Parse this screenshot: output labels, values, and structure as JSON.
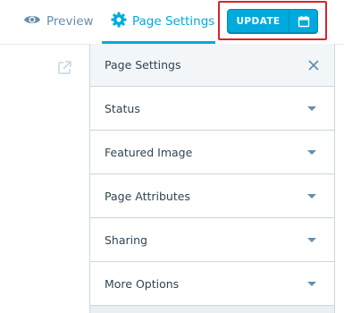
{
  "header": {
    "tabs": [
      {
        "label": "Preview",
        "icon": "eye-icon"
      },
      {
        "label": "Page Settings",
        "icon": "gear-icon",
        "active": true
      }
    ],
    "update_button": {
      "label": "UPDATE",
      "icon": "calendar-icon"
    },
    "accent_color": "#00aadc",
    "highlight_color": "#d9242a"
  },
  "sidebar": {
    "external_link_icon": "external-link-icon"
  },
  "panel": {
    "title": "Page Settings",
    "close_icon": "close-icon",
    "sections": [
      {
        "label": "Status"
      },
      {
        "label": "Featured Image"
      },
      {
        "label": "Page Attributes"
      },
      {
        "label": "Sharing"
      },
      {
        "label": "More Options"
      }
    ]
  }
}
